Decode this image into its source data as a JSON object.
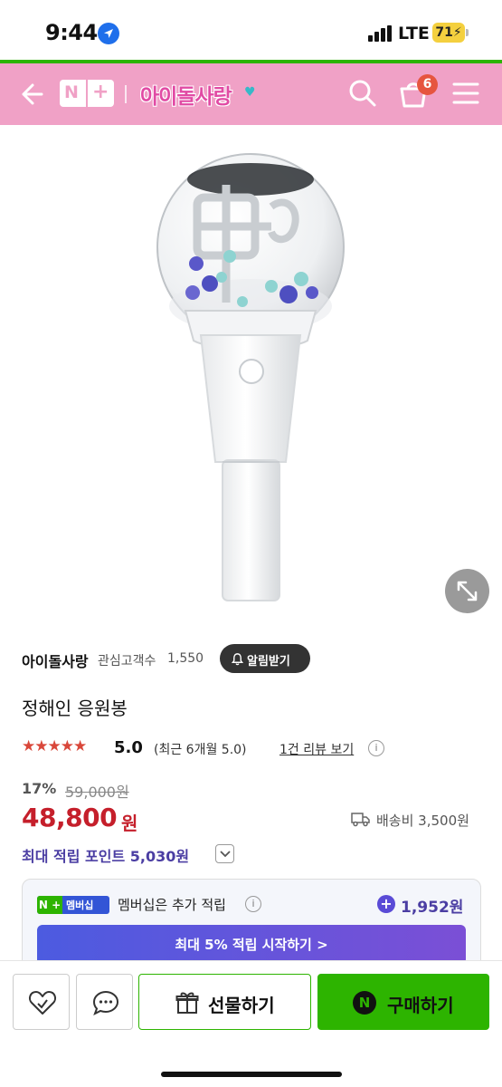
{
  "status_bar": {
    "time": "9:44",
    "network": "LTE",
    "battery": "71"
  },
  "header": {
    "brand": "아이돌사랑",
    "cart_count": "6",
    "nplus_n": "N",
    "nplus_plus": "+"
  },
  "product": {
    "seller": "아이돌사랑",
    "watchers_label": "관심고객수",
    "watchers_count": "1,550",
    "alert_label": "알림받기",
    "title": "정해인 응원봉",
    "rating": "5.0",
    "recent_rating": "(최근 6개월 5.0)",
    "review_link": "1건 리뷰 보기",
    "discount": "17%",
    "original_price": "59,000원",
    "price": "48,800",
    "price_unit": "원",
    "shipping": "배송비 3,500원",
    "points": "최대 적립 포인트 5,030원"
  },
  "membership": {
    "badge_n": "N +",
    "badge_label": "멤버십",
    "text": "멤버십은 추가 적립",
    "amount": "1,952원",
    "cta": "최대 5% 적립 시작하기 >"
  },
  "bottom_bar": {
    "gift_label": "선물하기",
    "buy_label": "구매하기",
    "buy_icon": "N"
  },
  "colors": {
    "header_pink": "#f0a1c6",
    "naver_green": "#2db400",
    "price_red": "#c51f2b",
    "points_purple": "#4b3ea3"
  }
}
